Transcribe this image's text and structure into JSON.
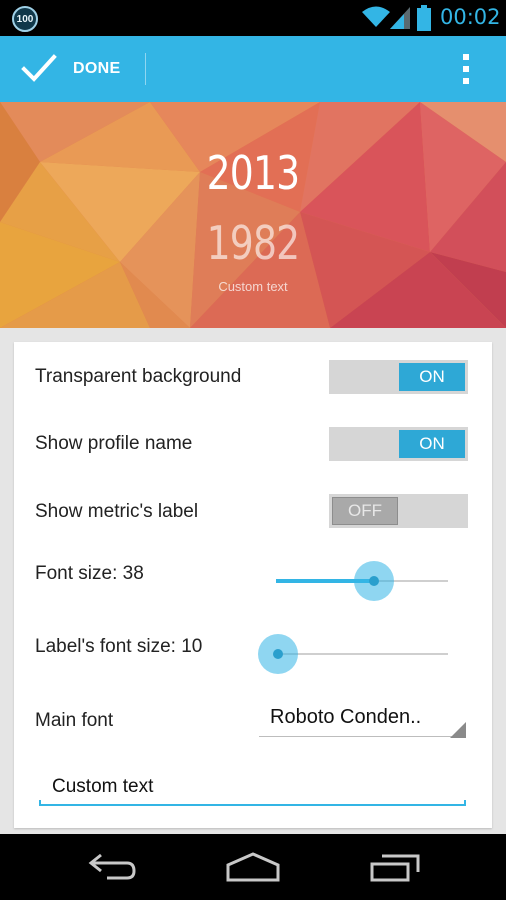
{
  "status_bar": {
    "notification_badge": "100",
    "time": "00:02",
    "icons": [
      "wifi-icon",
      "signal-icon",
      "battery-icon"
    ],
    "accent_color": "#33b5e5"
  },
  "action_bar": {
    "done_label": "DONE",
    "done_icon": "checkmark-icon",
    "overflow_icon": "overflow-menu-icon",
    "background_color": "#33b5e5"
  },
  "preview": {
    "year": "2013",
    "metric": "1982",
    "custom_text": "Custom text"
  },
  "settings": {
    "transparent_background": {
      "label": "Transparent background",
      "state": "ON"
    },
    "show_profile_name": {
      "label": "Show profile name",
      "state": "ON"
    },
    "show_metric_label": {
      "label": "Show metric's label",
      "state": "OFF"
    },
    "font_size": {
      "label": "Font size: 38",
      "value": 38,
      "level": 0.57
    },
    "label_font_size": {
      "label": "Label's font size: 10",
      "value": 10,
      "level": 0.0
    },
    "main_font": {
      "label": "Main font",
      "selected": "Roboto Conden.."
    },
    "custom_text_field": {
      "value": "Custom text"
    }
  },
  "nav_bar": {
    "icons": [
      "back-icon",
      "home-icon",
      "recent-apps-icon"
    ]
  }
}
